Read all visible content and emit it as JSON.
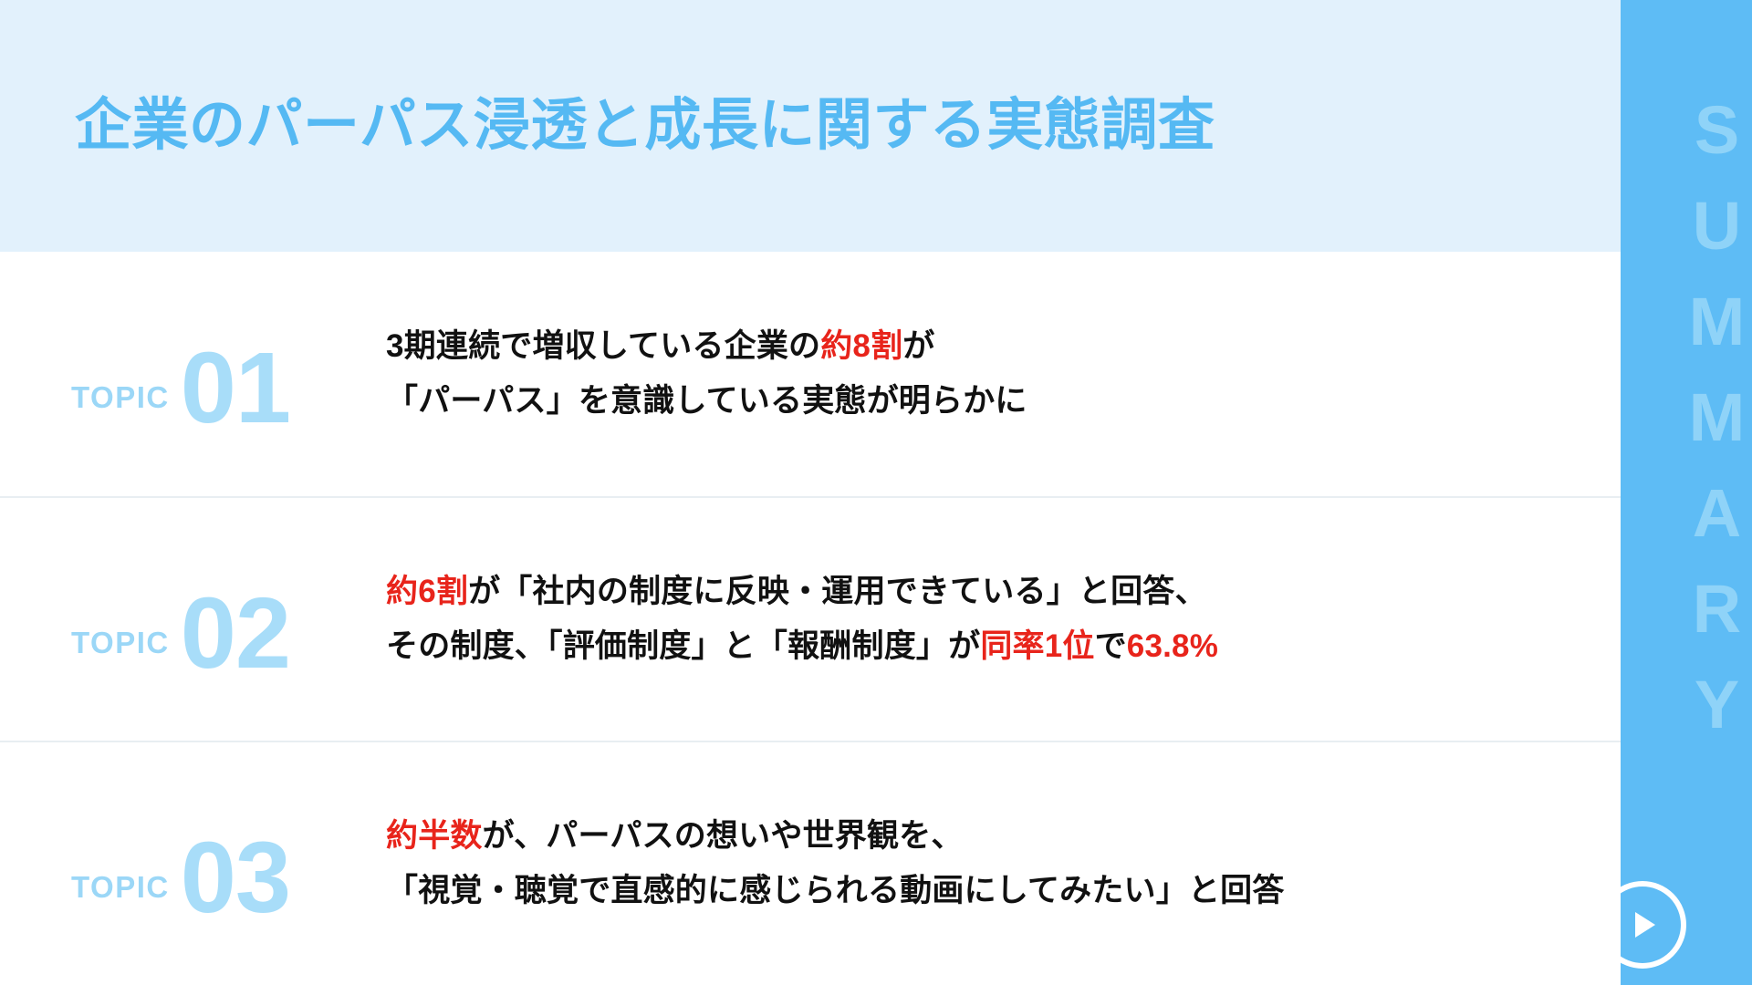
{
  "header": {
    "title": "企業のパーパス浸透と成長に関する実態調査",
    "background_color": "#e2f1fc",
    "title_color": "#55b9f3"
  },
  "sidebar": {
    "label": "SUMMARY",
    "background_color": "#5ebcf5",
    "label_color": "#8fd3f8",
    "logo": "play-circle-icon"
  },
  "topics": [
    {
      "label": "TOPIC",
      "number": "01",
      "lines": [
        [
          {
            "text": "3期連続で増収している企業の",
            "color": "#111111"
          },
          {
            "text": "約8割",
            "color": "#e8241b"
          },
          {
            "text": "が",
            "color": "#111111"
          }
        ],
        [
          {
            "text": "「パーパス」を意識している実態が明らかに",
            "color": "#111111"
          }
        ]
      ]
    },
    {
      "label": "TOPIC",
      "number": "02",
      "lines": [
        [
          {
            "text": "約6割",
            "color": "#e8241b"
          },
          {
            "text": "が「社内の制度に反映・運用できている」と回答、",
            "color": "#111111"
          }
        ],
        [
          {
            "text": "その制度、「評価制度」と「報酬制度」が",
            "color": "#111111"
          },
          {
            "text": "同率1位",
            "color": "#e8241b"
          },
          {
            "text": "で",
            "color": "#111111"
          },
          {
            "text": "63.8%",
            "color": "#e8241b"
          }
        ]
      ]
    },
    {
      "label": "TOPIC",
      "number": "03",
      "lines": [
        [
          {
            "text": "約半数",
            "color": "#e8241b"
          },
          {
            "text": "が、パーパスの想いや世界観を、",
            "color": "#111111"
          }
        ],
        [
          {
            "text": "「視覚・聴覚で直感的に感じられる動画にしてみたい」と回答",
            "color": "#111111"
          }
        ]
      ]
    }
  ],
  "colors": {
    "accent_blue": "#55b9f3",
    "light_blue": "#a8ddf9",
    "band_blue": "#e2f1fc",
    "highlight_red": "#e8241b",
    "text_black": "#111111",
    "divider": "#e8eef2"
  }
}
